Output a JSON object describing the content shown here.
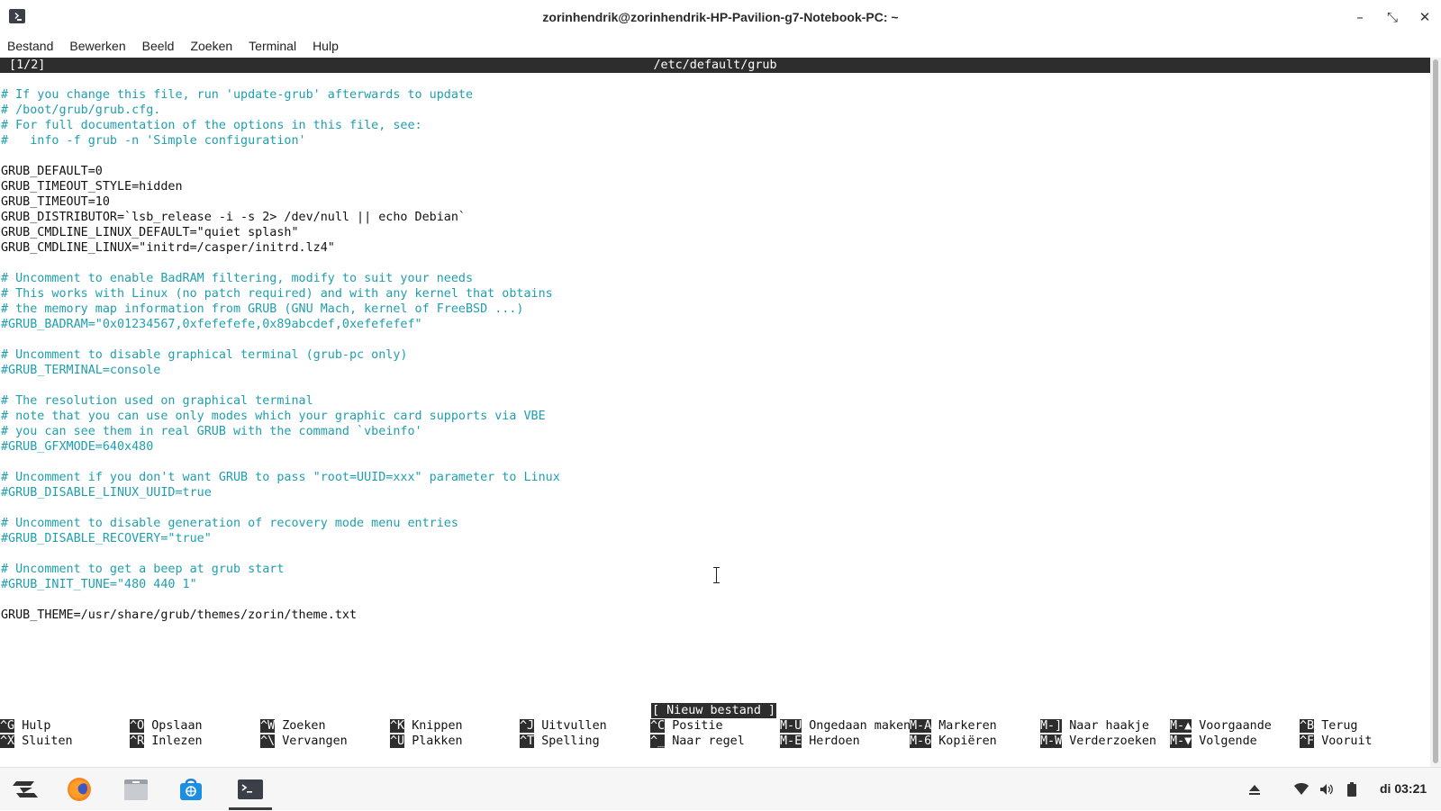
{
  "window": {
    "title": "zorinhendrik@zorinhendrik-HP-Pavilion-g7-Notebook-PC: ~",
    "controls": {
      "minimize": "–",
      "maximize": "⤡",
      "close": "✕"
    }
  },
  "menu": [
    "Bestand",
    "Bewerken",
    "Beeld",
    "Zoeken",
    "Terminal",
    "Hulp"
  ],
  "nano": {
    "buffer": " [1/2]",
    "filename": "/etc/default/grub",
    "lines": [
      {
        "t": "# If you change this file, run 'update-grub' afterwards to update",
        "c": true
      },
      {
        "t": "# /boot/grub/grub.cfg.",
        "c": true
      },
      {
        "t": "# For full documentation of the options in this file, see:",
        "c": true
      },
      {
        "t": "#   info -f grub -n 'Simple configuration'",
        "c": true
      },
      {
        "t": "",
        "c": false
      },
      {
        "t": "GRUB_DEFAULT=0",
        "c": false
      },
      {
        "t": "GRUB_TIMEOUT_STYLE=hidden",
        "c": false
      },
      {
        "t": "GRUB_TIMEOUT=10",
        "c": false
      },
      {
        "t": "GRUB_DISTRIBUTOR=`lsb_release -i -s 2> /dev/null || echo Debian`",
        "c": false
      },
      {
        "t": "GRUB_CMDLINE_LINUX_DEFAULT=\"quiet splash\"",
        "c": false
      },
      {
        "t": "GRUB_CMDLINE_LINUX=\"initrd=/casper/initrd.lz4\"",
        "c": false
      },
      {
        "t": "",
        "c": false
      },
      {
        "t": "# Uncomment to enable BadRAM filtering, modify to suit your needs",
        "c": true
      },
      {
        "t": "# This works with Linux (no patch required) and with any kernel that obtains",
        "c": true
      },
      {
        "t": "# the memory map information from GRUB (GNU Mach, kernel of FreeBSD ...)",
        "c": true
      },
      {
        "t": "#GRUB_BADRAM=\"0x01234567,0xfefefefe,0x89abcdef,0xefefefef\"",
        "c": true
      },
      {
        "t": "",
        "c": false
      },
      {
        "t": "# Uncomment to disable graphical terminal (grub-pc only)",
        "c": true
      },
      {
        "t": "#GRUB_TERMINAL=console",
        "c": true
      },
      {
        "t": "",
        "c": false
      },
      {
        "t": "# The resolution used on graphical terminal",
        "c": true
      },
      {
        "t": "# note that you can use only modes which your graphic card supports via VBE",
        "c": true
      },
      {
        "t": "# you can see them in real GRUB with the command `vbeinfo'",
        "c": true
      },
      {
        "t": "#GRUB_GFXMODE=640x480",
        "c": true
      },
      {
        "t": "",
        "c": false
      },
      {
        "t": "# Uncomment if you don't want GRUB to pass \"root=UUID=xxx\" parameter to Linux",
        "c": true
      },
      {
        "t": "#GRUB_DISABLE_LINUX_UUID=true",
        "c": true
      },
      {
        "t": "",
        "c": false
      },
      {
        "t": "# Uncomment to disable generation of recovery mode menu entries",
        "c": true
      },
      {
        "t": "#GRUB_DISABLE_RECOVERY=\"true\"",
        "c": true
      },
      {
        "t": "",
        "c": false
      },
      {
        "t": "# Uncomment to get a beep at grub start",
        "c": true
      },
      {
        "t": "#GRUB_INIT_TUNE=\"480 440 1\"",
        "c": true
      },
      {
        "t": "",
        "c": false
      },
      {
        "t": "GRUB_THEME=/usr/share/grub/themes/zorin/theme.txt",
        "c": false
      }
    ],
    "status": "[ Nieuw bestand ]",
    "shortcuts": [
      [
        {
          "k": "^G",
          "l": "Hulp"
        },
        {
          "k": "^X",
          "l": "Sluiten"
        }
      ],
      [
        {
          "k": "^O",
          "l": "Opslaan"
        },
        {
          "k": "^R",
          "l": "Inlezen"
        }
      ],
      [
        {
          "k": "^W",
          "l": "Zoeken"
        },
        {
          "k": "^\\",
          "l": "Vervangen"
        }
      ],
      [
        {
          "k": "^K",
          "l": "Knippen"
        },
        {
          "k": "^U",
          "l": "Plakken"
        }
      ],
      [
        {
          "k": "^J",
          "l": "Uitvullen"
        },
        {
          "k": "^T",
          "l": "Spelling"
        }
      ],
      [
        {
          "k": "^C",
          "l": "Positie"
        },
        {
          "k": "^_",
          "l": "Naar regel"
        }
      ],
      [
        {
          "k": "M-U",
          "l": "Ongedaan maken"
        },
        {
          "k": "M-E",
          "l": "Herdoen"
        }
      ],
      [
        {
          "k": "M-A",
          "l": "Markeren"
        },
        {
          "k": "M-6",
          "l": "Kopiëren"
        }
      ],
      [
        {
          "k": "M-]",
          "l": "Naar haakje"
        },
        {
          "k": "M-W",
          "l": "Verderzoeken"
        }
      ],
      [
        {
          "k": "M-▲",
          "l": "Voorgaande"
        },
        {
          "k": "M-▼",
          "l": "Volgende"
        }
      ],
      [
        {
          "k": "^B",
          "l": "Terug"
        },
        {
          "k": "^F",
          "l": "Vooruit"
        }
      ]
    ]
  },
  "taskbar": {
    "apps": [
      {
        "name": "zorin-menu-icon"
      },
      {
        "name": "firefox-icon"
      },
      {
        "name": "files-icon"
      },
      {
        "name": "software-store-icon"
      },
      {
        "name": "terminal-icon"
      }
    ],
    "clock": "di 03:21"
  },
  "colors": {
    "comment": "#1f9fae",
    "header_bg": "#2d2d2d"
  }
}
